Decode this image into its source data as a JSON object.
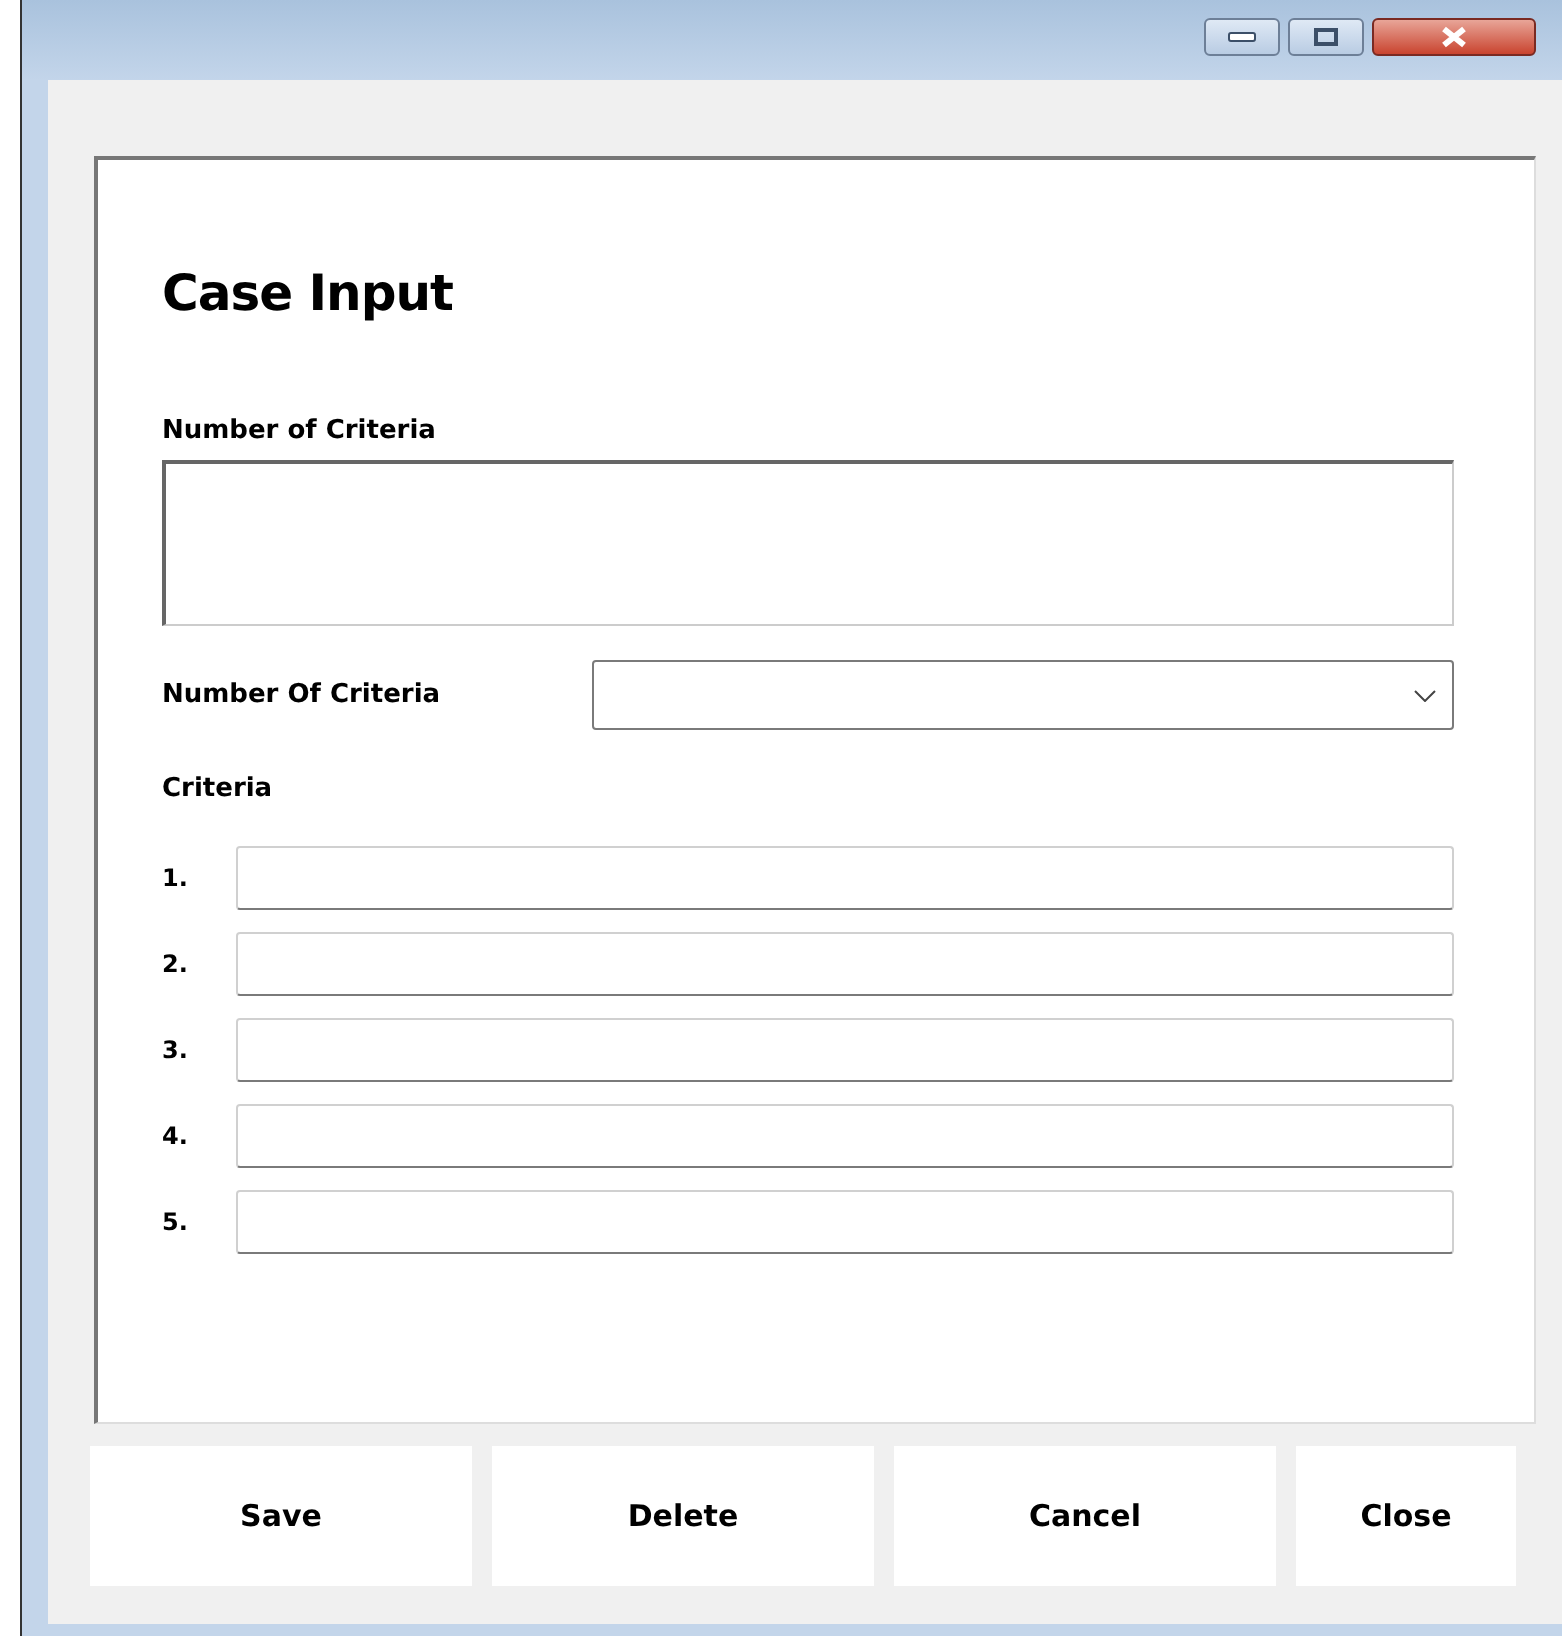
{
  "form": {
    "title": "Case Input",
    "description_label": "Number of Criteria",
    "count_label": "Number Of Criteria",
    "criteria_label": "Criteria",
    "criteria": [
      {
        "number": "1."
      },
      {
        "number": "2."
      },
      {
        "number": "3."
      },
      {
        "number": "4."
      },
      {
        "number": "5."
      }
    ]
  },
  "buttons": [
    {
      "label": "Save"
    },
    {
      "label": "Delete"
    },
    {
      "label": "Cancel"
    },
    {
      "label": "Close"
    }
  ]
}
